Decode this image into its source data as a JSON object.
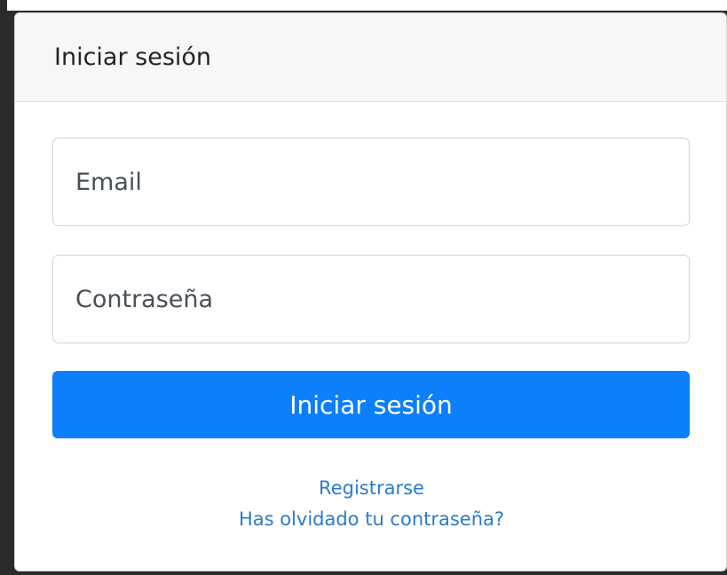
{
  "card": {
    "title": "Iniciar sesión"
  },
  "form": {
    "email_placeholder": "Email",
    "password_placeholder": "Contraseña",
    "submit_label": "Iniciar sesión"
  },
  "links": {
    "register": "Registrarse",
    "forgot_password": "Has olvidado tu contraseña?"
  },
  "colors": {
    "primary_button": "#0d7ffb",
    "link": "#2a7ccb",
    "header_bg": "#f7f7f7"
  }
}
